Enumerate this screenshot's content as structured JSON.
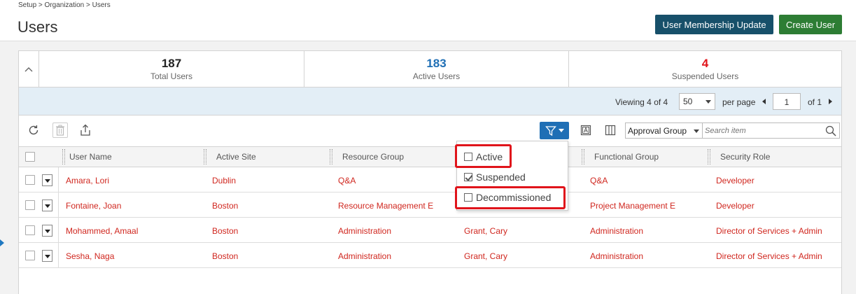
{
  "breadcrumb": "Setup > Organization > Users",
  "title": "Users",
  "buttons": {
    "membership": "User Membership Update",
    "create": "Create User"
  },
  "stats": [
    {
      "value": "187",
      "label": "Total Users",
      "color": "#222222"
    },
    {
      "value": "183",
      "label": "Active Users",
      "color": "#1f6fb5"
    },
    {
      "value": "4",
      "label": "Suspended Users",
      "color": "#e0141b"
    }
  ],
  "pager": {
    "viewing_prefix": "Viewing",
    "viewing_count": "4",
    "viewing_of": "of",
    "viewing_total": "4",
    "per_page_value": "50",
    "per_page_label": "per page",
    "page": "1",
    "of_pages": "of 1"
  },
  "toolbar": {
    "group_select": "Approval Group",
    "search_placeholder": "Search item"
  },
  "columns": [
    "User Name",
    "Active Site",
    "Resource Group",
    "Functional Group",
    "Security Role"
  ],
  "rows": [
    {
      "name": "Amara, Lori",
      "site": "Dublin",
      "resource_group": "Q&A",
      "col4": "",
      "functional_group": "Q&A",
      "role": "Developer"
    },
    {
      "name": "Fontaine, Joan",
      "site": "Boston",
      "resource_group": "Resource Management E",
      "col4": "",
      "functional_group": "Project Management E",
      "role": "Developer"
    },
    {
      "name": "Mohammed, Amaal",
      "site": "Boston",
      "resource_group": "Administration",
      "col4": "Grant, Cary",
      "functional_group": "Administration",
      "role": "Director of Services + Admin"
    },
    {
      "name": "Sesha, Naga",
      "site": "Boston",
      "resource_group": "Administration",
      "col4": "Grant, Cary",
      "functional_group": "Administration",
      "role": "Director of Services + Admin"
    }
  ],
  "filter_menu": [
    {
      "label": "Active",
      "checked": false
    },
    {
      "label": "Suspended",
      "checked": true
    },
    {
      "label": "Decommissioned",
      "checked": false
    }
  ],
  "colors": {
    "link_red": "#d0271f",
    "highlight": "#e0141b",
    "primary_blue": "#1f6fb5"
  }
}
